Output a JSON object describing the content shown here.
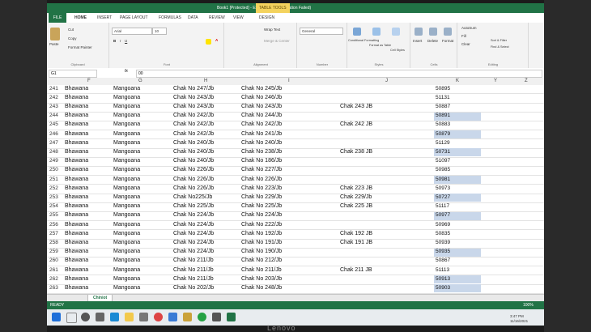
{
  "window": {
    "title": "Book1 [Protected] - Excel (Product Activation Failed)",
    "context_tab": "TABLE TOOLS"
  },
  "ribbon_tabs": [
    "FILE",
    "HOME",
    "INSERT",
    "PAGE LAYOUT",
    "FORMULAS",
    "DATA",
    "REVIEW",
    "VIEW",
    "DESIGN"
  ],
  "ribbon": {
    "clipboard": {
      "cut": "Cut",
      "copy": "Copy",
      "format_painter": "Format Painter",
      "paste": "Paste",
      "label": "Clipboard"
    },
    "font": {
      "name": "Arial",
      "size": "10",
      "label": "Font"
    },
    "alignment": {
      "wrap": "Wrap Text",
      "merge": "Merge & Center",
      "label": "Alignment"
    },
    "number": {
      "format": "General",
      "label": "Number"
    },
    "styles": {
      "conditional": "Conditional Formatting",
      "format_table": "Format as Table",
      "cell_styles": "Cell Styles",
      "label": "Styles"
    },
    "cells": {
      "insert": "Insert",
      "delete": "Delete",
      "format": "Format",
      "label": "Cells"
    },
    "editing": {
      "autosum": "AutoSum",
      "fill": "Fill",
      "clear": "Clear",
      "sort": "Sort & Filter",
      "find": "Find & Select",
      "label": "Editing"
    }
  },
  "formula_bar": {
    "name_box": "G1",
    "fx": "fx",
    "value": "00"
  },
  "columns": [
    "F",
    "G",
    "H",
    "I",
    "J",
    "K",
    "Y",
    "Z"
  ],
  "rows": [
    {
      "n": "241",
      "f": "Bhawana",
      "g": "Mangoana",
      "h": "Chak No 247/Jb",
      "i": "Chak No 245/Jb",
      "j": "",
      "k": "50895"
    },
    {
      "n": "242",
      "f": "Bhawana",
      "g": "Mangoana",
      "h": "Chak No 243/Jb",
      "i": "Chak No 246/Jb",
      "j": "",
      "k": "51131"
    },
    {
      "n": "243",
      "f": "Bhawana",
      "g": "Mangoana",
      "h": "Chak No 243/Jb",
      "i": "Chak No 243/Jb",
      "j": "Chak 243 JB",
      "k": "50887"
    },
    {
      "n": "244",
      "f": "Bhawana",
      "g": "Mangoana",
      "h": "Chak No 242/Jb",
      "i": "Chak No 244/Jb",
      "j": "",
      "k": "50891"
    },
    {
      "n": "245",
      "f": "Bhawana",
      "g": "Mangoana",
      "h": "Chak No 242/Jb",
      "i": "Chak No 242/Jb",
      "j": "Chak 242 JB",
      "k": "50883"
    },
    {
      "n": "246",
      "f": "Bhawana",
      "g": "Mangoana",
      "h": "Chak No 242/Jb",
      "i": "Chak No 241/Jb",
      "j": "",
      "k": "50879"
    },
    {
      "n": "247",
      "f": "Bhawana",
      "g": "Mangoana",
      "h": "Chak No 240/Jb",
      "i": "Chak No 240/Jb",
      "j": "",
      "k": "51129"
    },
    {
      "n": "248",
      "f": "Bhawana",
      "g": "Mangoana",
      "h": "Chak No 240/Jb",
      "i": "Chak No 238/Jb",
      "j": "Chak 238 JB",
      "k": "50731"
    },
    {
      "n": "249",
      "f": "Bhawana",
      "g": "Mangoana",
      "h": "Chak No 240/Jb",
      "i": "Chak No 186/Jb",
      "j": "",
      "k": "51097"
    },
    {
      "n": "250",
      "f": "Bhawana",
      "g": "Mangoana",
      "h": "Chak No 226/Jb",
      "i": "Chak No 227/Jb",
      "j": "",
      "k": "50985"
    },
    {
      "n": "251",
      "f": "Bhawana",
      "g": "Mangoana",
      "h": "Chak No 226/Jb",
      "i": "Chak No 226/Jb",
      "j": "",
      "k": "50981"
    },
    {
      "n": "252",
      "f": "Bhawana",
      "g": "Mangoana",
      "h": "Chak No 226/Jb",
      "i": "Chak No 223/Jb",
      "j": "Chak 223 JB",
      "k": "50973"
    },
    {
      "n": "253",
      "f": "Bhawana",
      "g": "Mangoana",
      "h": "Chak No225/Jb",
      "i": "Chak No 229/Jb",
      "j": "Chak 229/Jb",
      "k": "50727"
    },
    {
      "n": "254",
      "f": "Bhawana",
      "g": "Mangoana",
      "h": "Chak No 225/Jb",
      "i": "Chak No 225/Jb",
      "j": "Chak 225 JB",
      "k": "51117"
    },
    {
      "n": "255",
      "f": "Bhawana",
      "g": "Mangoana",
      "h": "Chak No 224/Jb",
      "i": "Chak No 224/Jb",
      "j": "",
      "k": "50977"
    },
    {
      "n": "256",
      "f": "Bhawana",
      "g": "Mangoana",
      "h": "Chak No 224/Jb",
      "i": "Chak No 222/Jb",
      "j": "",
      "k": "50969"
    },
    {
      "n": "257",
      "f": "Bhawana",
      "g": "Mangoana",
      "h": "Chak No 224/Jb",
      "i": "Chak No 192/Jb",
      "j": "Chak 192 JB",
      "k": "50835"
    },
    {
      "n": "258",
      "f": "Bhawana",
      "g": "Mangoana",
      "h": "Chak No 224/Jb",
      "i": "Chak No 191/Jb",
      "j": "Chak 191 JB",
      "k": "50939"
    },
    {
      "n": "259",
      "f": "Bhawana",
      "g": "Mangoana",
      "h": "Chak No 224/Jb",
      "i": "Chak No 190/Jb",
      "j": "",
      "k": "50935"
    },
    {
      "n": "260",
      "f": "Bhawana",
      "g": "Mangoana",
      "h": "Chak No 211/Jb",
      "i": "Chak No 212/Jb",
      "j": "",
      "k": "50867"
    },
    {
      "n": "261",
      "f": "Bhawana",
      "g": "Mangoana",
      "h": "Chak No 211/Jb",
      "i": "Chak No 211/Jb",
      "j": "Chak 211 JB",
      "k": "51113"
    },
    {
      "n": "262",
      "f": "Bhawana",
      "g": "Mangoana",
      "h": "Chak No 211/Jb",
      "i": "Chak No 203/Jb",
      "j": "",
      "k": "50913"
    },
    {
      "n": "263",
      "f": "Bhawana",
      "g": "Mangoana",
      "h": "Chak No 202/Jb",
      "i": "Chak No 248/Jb",
      "j": "",
      "k": "50903"
    }
  ],
  "highlighted_k_rows": [
    3,
    5,
    7,
    10,
    12,
    14,
    18,
    21,
    22
  ],
  "sheet_tab": "Chiniot",
  "status": {
    "left": "READY",
    "zoom": "100%"
  },
  "clock": {
    "time": "3:47 PM",
    "date": "11/16/2021"
  },
  "monitor_brand": "Lenovo",
  "colors": {
    "excel_green": "#217346",
    "selection_blue": "#c9d7ea"
  }
}
